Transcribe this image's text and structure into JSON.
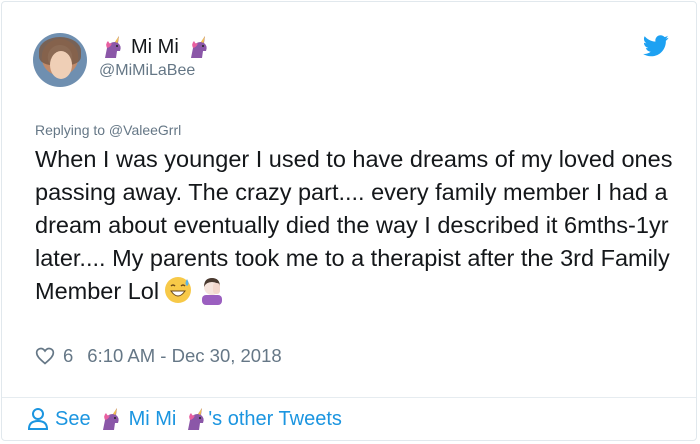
{
  "user": {
    "display_name": "Mi Mi",
    "handle": "@MiMiLaBee",
    "avatar_icon": "profile-photo",
    "name_prefix_icon": "unicorn-icon",
    "name_suffix_icon": "unicorn-icon"
  },
  "reply": {
    "text": "Replying to @ValeeGrrl"
  },
  "tweet": {
    "text": "When I was younger I used to have dreams of my loved ones passing away. The crazy part.... every family member I had a dream about eventually died the way I described it 6mths-1yr later.... My parents took me to a therapist after the 3rd Family Member Lol",
    "trailing_emojis": [
      "sweat-smile-emoji",
      "woman-facepalming-emoji"
    ]
  },
  "meta": {
    "like_count": "6",
    "timestamp": "6:10 AM - Dec 30, 2018"
  },
  "footer": {
    "see_label": "See",
    "name": "Mi Mi",
    "suffix": "'s other Tweets"
  },
  "colors": {
    "brand_blue": "#1da1f2",
    "link_blue": "#1b95e0",
    "text": "#14171a",
    "secondary_text": "#657786",
    "unicorn_purple": "#8b57a8"
  }
}
